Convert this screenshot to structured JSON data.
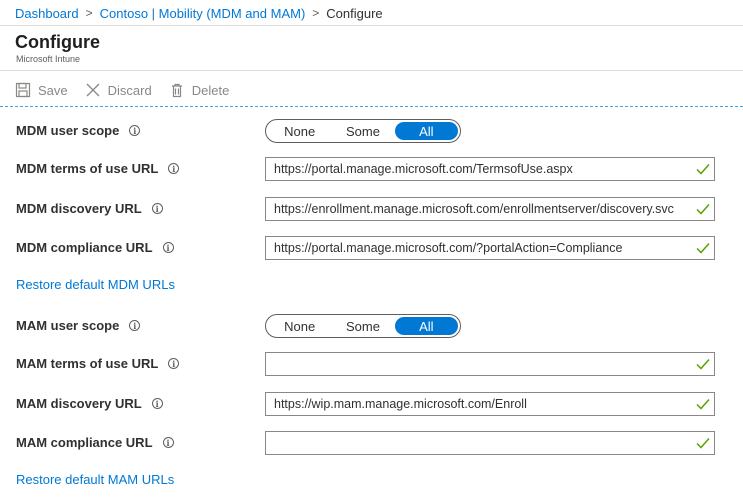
{
  "breadcrumb": {
    "items": [
      "Dashboard",
      "Contoso | Mobility (MDM and MAM)"
    ],
    "current": "Configure"
  },
  "header": {
    "title": "Configure",
    "subtitle": "Microsoft Intune"
  },
  "toolbar": {
    "save": "Save",
    "discard": "Discard",
    "delete": "Delete"
  },
  "mdm": {
    "scope_label": "MDM user scope",
    "scope_options": [
      "None",
      "Some",
      "All"
    ],
    "scope_selected": "All",
    "terms_label": "MDM terms of use URL",
    "terms_value": "https://portal.manage.microsoft.com/TermsofUse.aspx",
    "discovery_label": "MDM discovery URL",
    "discovery_value": "https://enrollment.manage.microsoft.com/enrollmentserver/discovery.svc",
    "compliance_label": "MDM compliance URL",
    "compliance_value": "https://portal.manage.microsoft.com/?portalAction=Compliance",
    "restore_link": "Restore default MDM URLs"
  },
  "mam": {
    "scope_label": "MAM user scope",
    "scope_options": [
      "None",
      "Some",
      "All"
    ],
    "scope_selected": "All",
    "terms_label": "MAM terms of use URL",
    "terms_value": "",
    "discovery_label": "MAM discovery URL",
    "discovery_value": "https://wip.mam.manage.microsoft.com/Enroll",
    "compliance_label": "MAM compliance URL",
    "compliance_value": "",
    "restore_link": "Restore default MAM URLs"
  },
  "colors": {
    "accent": "#0078d4",
    "valid_check": "#57a300"
  },
  "icons": {
    "save": "save-icon",
    "discard": "close-icon",
    "delete": "trash-icon",
    "info": "info-icon",
    "check": "checkmark-icon",
    "chevron": "chevron-right-icon"
  }
}
